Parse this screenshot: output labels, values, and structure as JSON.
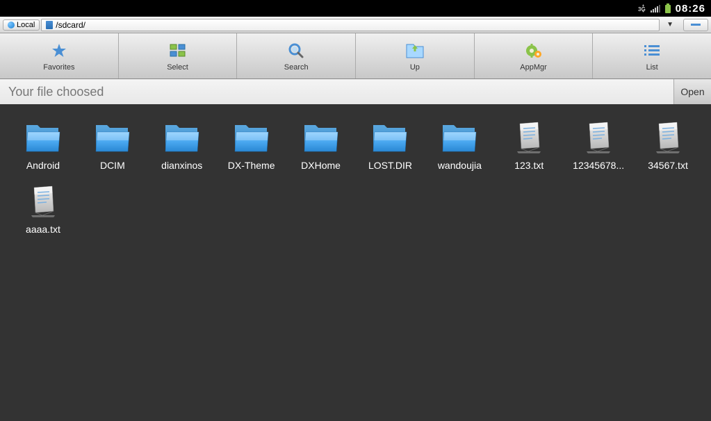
{
  "status_bar": {
    "time": "08:26"
  },
  "location_bar": {
    "local_label": "Local",
    "path": "/sdcard/"
  },
  "toolbar": {
    "favorites_label": "Favorites",
    "select_label": "Select",
    "search_label": "Search",
    "up_label": "Up",
    "appmgr_label": "AppMgr",
    "list_label": "List"
  },
  "path_bar": {
    "placeholder": "Your file choosed",
    "open_label": "Open"
  },
  "files": [
    {
      "name": "Android",
      "type": "folder"
    },
    {
      "name": "DCIM",
      "type": "folder"
    },
    {
      "name": "dianxinos",
      "type": "folder"
    },
    {
      "name": "DX-Theme",
      "type": "folder"
    },
    {
      "name": "DXHome",
      "type": "folder"
    },
    {
      "name": "LOST.DIR",
      "type": "folder"
    },
    {
      "name": "wandoujia",
      "type": "folder"
    },
    {
      "name": "123.txt",
      "type": "file"
    },
    {
      "name": "12345678...",
      "type": "file"
    },
    {
      "name": "34567.txt",
      "type": "file"
    },
    {
      "name": "aaaa.txt",
      "type": "file"
    }
  ]
}
